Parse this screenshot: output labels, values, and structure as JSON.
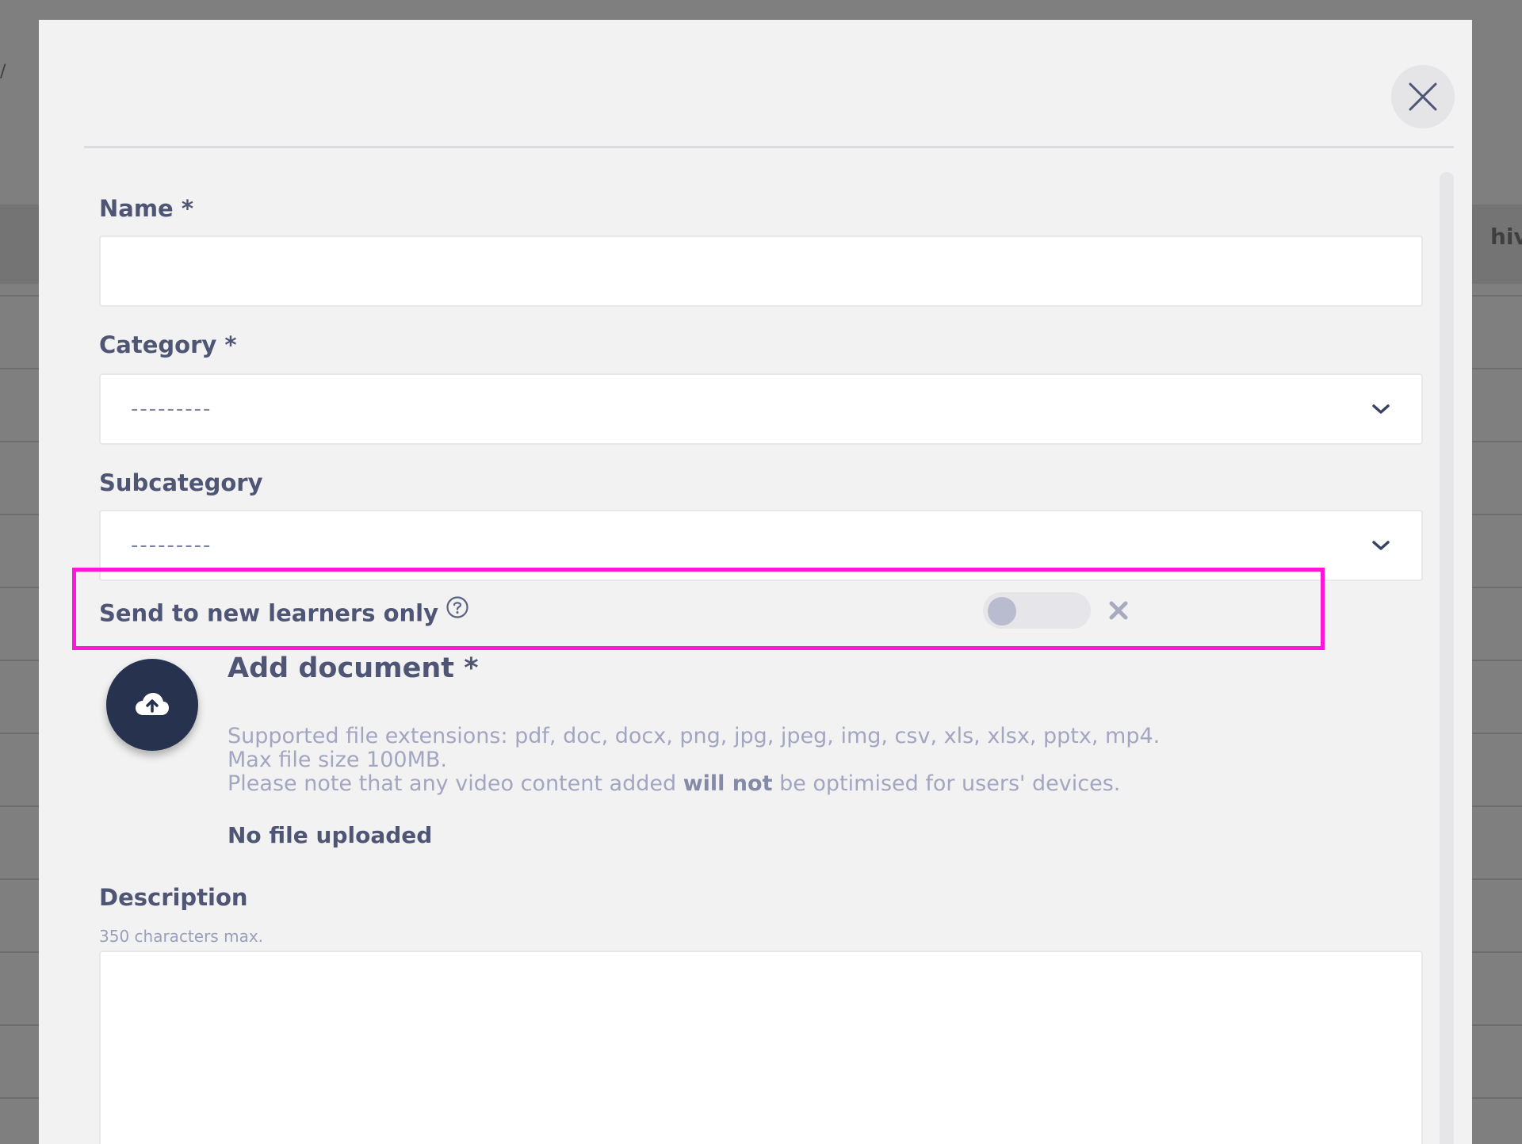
{
  "background": {
    "partial_text": "hiv",
    "partial_mark": "/"
  },
  "modal": {
    "form": {
      "name": {
        "label": "Name",
        "required_mark": "*",
        "value": ""
      },
      "category": {
        "label": "Category",
        "required_mark": "*",
        "selected": "---------"
      },
      "subcategory": {
        "label": "Subcategory",
        "selected": "---------"
      },
      "new_learners": {
        "label": "Send to new learners only",
        "toggle_on": false
      },
      "document": {
        "title": "Add document",
        "required_mark": "*",
        "line1": "Supported file extensions: pdf, doc, docx, png, jpg, jpeg, img, csv, xls, xlsx, pptx, mp4.",
        "line2": "Max file size 100MB.",
        "line3_pre": "Please note that any video content added ",
        "line3_bold": "will not",
        "line3_post": " be optimised for users' devices.",
        "status": "No file uploaded"
      },
      "description": {
        "label": "Description",
        "hint": "350 characters max.",
        "value": ""
      }
    }
  },
  "colors": {
    "highlight": "#ff16d8",
    "upload_button": "#27324f",
    "label": "#4f5574",
    "muted_text": "#a2a6c1",
    "overlay": "#7f7f7f"
  },
  "icons": {
    "close": "close-icon",
    "help": "help-icon",
    "chevron": "chevron-down-icon",
    "upload": "cloud-upload-icon",
    "cancel": "x-icon"
  }
}
